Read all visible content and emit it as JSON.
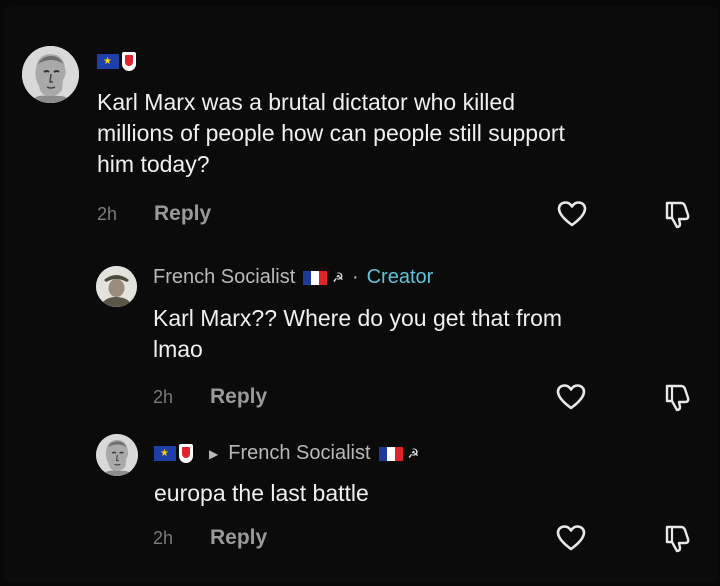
{
  "comments": [
    {
      "author": "",
      "text_lines": [
        "Karl Marx was a brutal dictator who killed",
        "millions of people how can people still support",
        "him today?"
      ],
      "time": "2h",
      "reply_label": "Reply"
    },
    {
      "author": "French Socialist",
      "creator_label": "Creator",
      "separator": "·",
      "text_lines": [
        "Karl Marx?? Where do you get that from",
        "lmao"
      ],
      "time": "2h",
      "reply_label": "Reply"
    },
    {
      "author": "",
      "reply_to": "French Socialist",
      "text_lines": [
        "europa the last battle"
      ],
      "time": "2h",
      "reply_label": "Reply"
    }
  ],
  "icons": {
    "like": "heart-outline-icon",
    "dislike": "thumbs-down-outline-icon",
    "reply_arrow": "caret-right-icon",
    "flags": [
      "eu-flag-icon",
      "red-white-shield-icon",
      "french-flag-icon",
      "hammer-sickle-icon"
    ]
  },
  "colors": {
    "background": "#0b0b0b",
    "creator_accent": "#5fc2d6",
    "text": "#f0f0f0",
    "muted": "#9a9a9a"
  }
}
